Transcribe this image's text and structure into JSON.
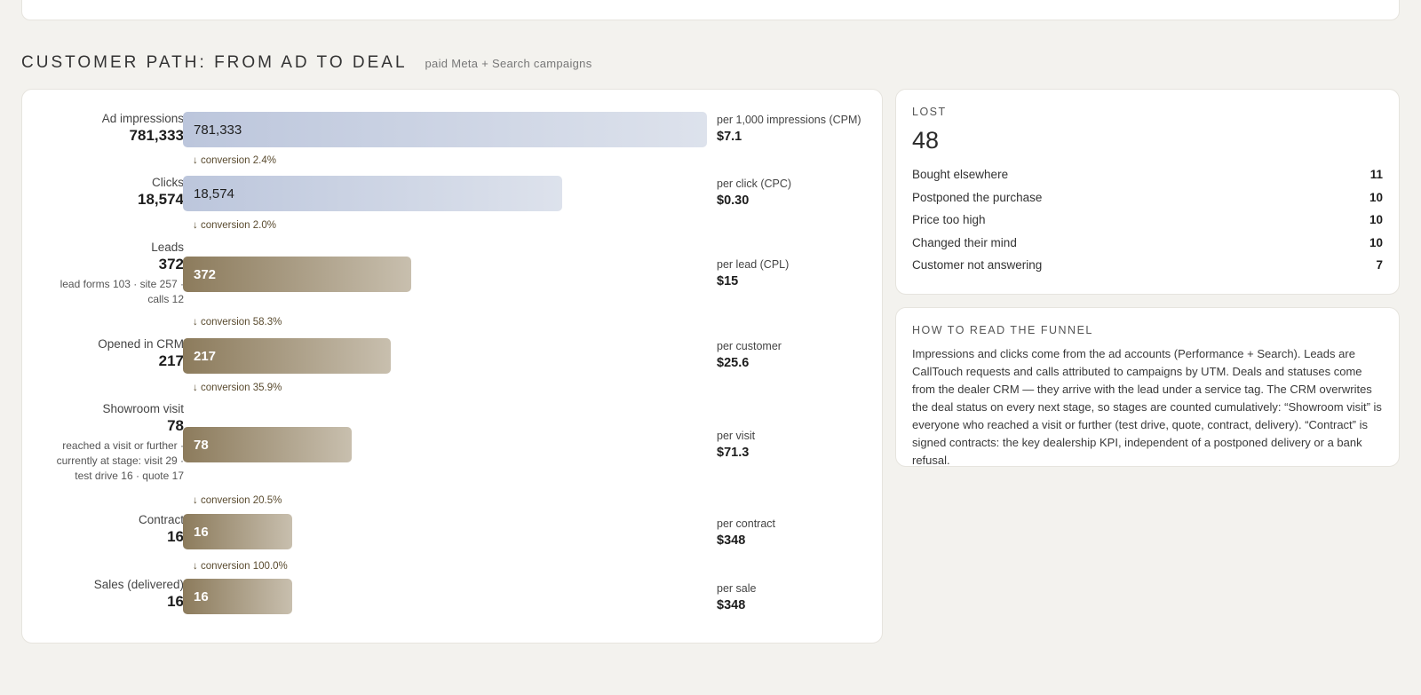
{
  "section": {
    "title": "CUSTOMER PATH: FROM AD TO DEAL",
    "subtitle": "paid Meta + Search campaigns"
  },
  "stages": [
    {
      "name": "Ad impressions",
      "value": "781,333",
      "bar_label": "781,333",
      "bar_fraction": 1.0,
      "style": "blue",
      "cost_label": "per 1,000 impressions (CPM)",
      "cost_value": "$7.1"
    },
    {
      "name": "Clicks",
      "value": "18,574",
      "bar_label": "18,574",
      "bar_fraction": 0.724,
      "style": "blue",
      "cost_label": "per click (CPC)",
      "cost_value": "$0.30"
    },
    {
      "name": "Leads",
      "value": "372",
      "note": "lead forms 103 · site 257 · calls 12",
      "bar_label": "372",
      "bar_fraction": 0.436,
      "style": "tan",
      "cost_label": "per lead (CPL)",
      "cost_value": "$15"
    },
    {
      "name": "Opened in CRM",
      "value": "217",
      "bar_label": "217",
      "bar_fraction": 0.397,
      "style": "tan",
      "cost_label": "per customer",
      "cost_value": "$25.6"
    },
    {
      "name": "Showroom visit",
      "value": "78",
      "note": "reached a visit or further · currently at stage: visit 29 · test drive 16 · quote 17",
      "bar_label": "78",
      "bar_fraction": 0.322,
      "style": "tan",
      "cost_label": "per visit",
      "cost_value": "$71.3"
    },
    {
      "name": "Contract",
      "value": "16",
      "bar_label": "16",
      "bar_fraction": 0.209,
      "style": "tan",
      "cost_label": "per contract",
      "cost_value": "$348"
    },
    {
      "name": "Sales (delivered)",
      "value": "16",
      "bar_label": "16",
      "bar_fraction": 0.209,
      "style": "tan",
      "cost_label": "per sale",
      "cost_value": "$348"
    }
  ],
  "conversions": [
    "↓ conversion 2.4%",
    "↓ conversion 2.0%",
    "↓ conversion 58.3%",
    "↓ conversion 35.9%",
    "↓ conversion 20.5%",
    "↓ conversion 100.0%"
  ],
  "lost": {
    "title": "LOST",
    "total": "48",
    "reasons": [
      {
        "label": "Bought elsewhere",
        "count": "11"
      },
      {
        "label": "Postponed the purchase",
        "count": "10"
      },
      {
        "label": "Price too high",
        "count": "10"
      },
      {
        "label": "Changed their mind",
        "count": "10"
      },
      {
        "label": "Customer not answering",
        "count": "7"
      }
    ]
  },
  "how_to_read": {
    "title": "HOW TO READ THE FUNNEL",
    "text": "Impressions and clicks come from the ad accounts (Performance + Search). Leads are CallTouch requests and calls attributed to campaigns by UTM. Deals and statuses come from the dealer CRM — they arrive with the lead under a service tag. The CRM overwrites the deal status on every next stage, so stages are counted cumulatively: “Showroom visit” is everyone who reached a visit or further (test drive, quote, contract, delivery). “Contract” is signed contracts: the key dealership KPI, independent of a postponed delivery or a bank refusal."
  },
  "colors": {
    "bar_blue": "#bcc6dc",
    "bar_tan": "#8c7b5c",
    "background": "#f3f2ee"
  }
}
